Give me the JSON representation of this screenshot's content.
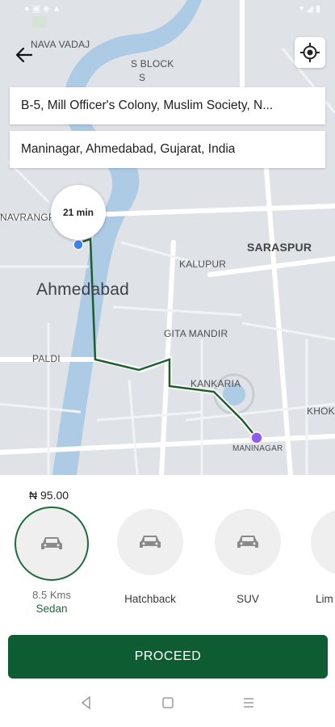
{
  "map": {
    "labels": {
      "nava_vadaj": "NAVA VADAJ",
      "s_block": "S BLOCK",
      "s_letter": "S",
      "navrangpura": "NAVRANGP",
      "ahmedabad": "Ahmedabad",
      "kalupur": "KALUPUR",
      "saraspur": "SARASPUR",
      "gita_mandir": "GITA MANDIR",
      "paldi": "PALDI",
      "kankaria": "KANKARIA",
      "maninagar": "MANINAGAR",
      "khokhra": "KHOK"
    },
    "eta": "21 min",
    "route_color": "#1e5e2d"
  },
  "search": {
    "from": "B-5, Mill Officer's Colony, Muslim Society, N...",
    "to": "Maninagar, Ahmedabad, Gujarat, India"
  },
  "booking": {
    "price": "₦ 95.00",
    "vehicles": [
      {
        "distance": "8.5 Kms",
        "name": "Sedan"
      },
      {
        "name": "Hatchback"
      },
      {
        "name": "SUV"
      },
      {
        "name": "Lim"
      }
    ],
    "proceed_label": "PROCEED",
    "accent": "#0d5c32"
  }
}
